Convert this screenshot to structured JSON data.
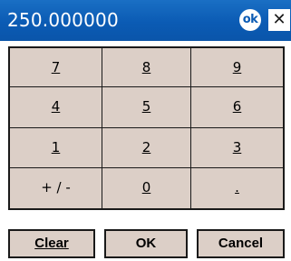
{
  "titlebar": {
    "value": "250.000000",
    "ok_icon_text": "ok",
    "close_glyph": "✕"
  },
  "keypad": {
    "keys": [
      "7",
      "8",
      "9",
      "4",
      "5",
      "6",
      "1",
      "2",
      "3",
      "+ / -",
      "0",
      "."
    ]
  },
  "actions": {
    "clear_label": "Clear",
    "ok_label": "OK",
    "cancel_label": "Cancel"
  },
  "colors": {
    "titlebar": "#0b5bb4",
    "key_face": "#dccfc7",
    "border": "#1a1a1a"
  }
}
